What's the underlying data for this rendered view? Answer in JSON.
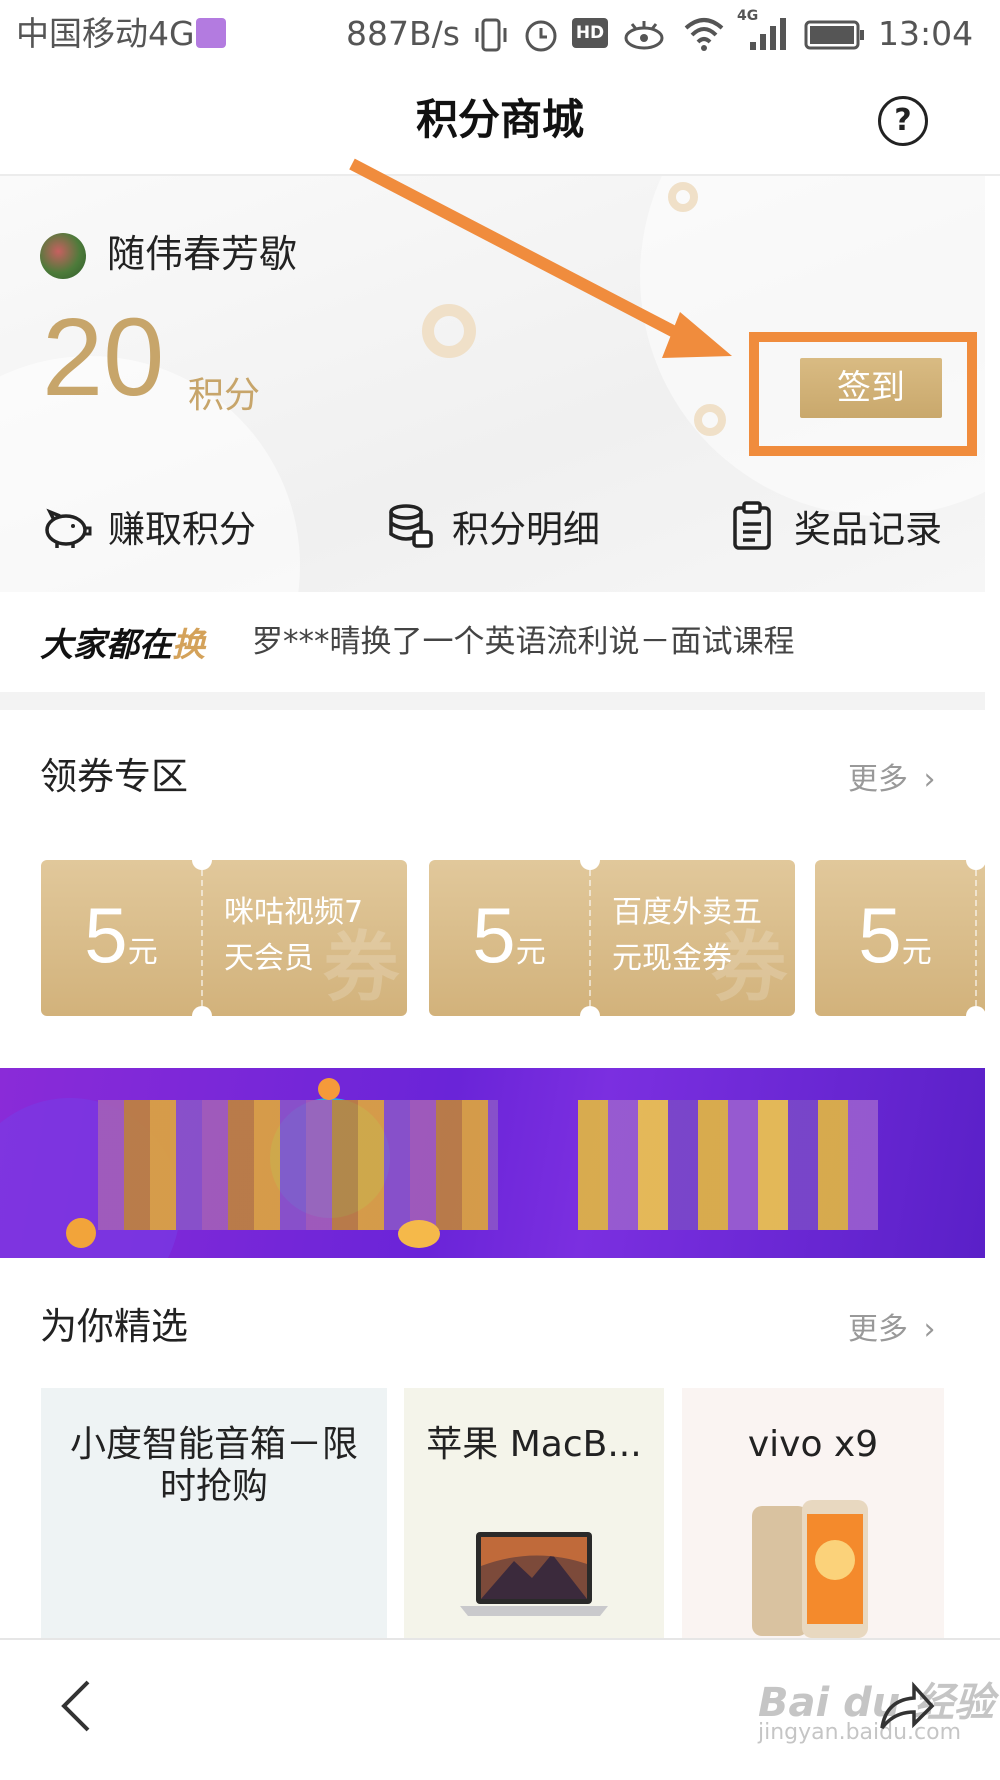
{
  "status_bar": {
    "carrier": "中国移动4G",
    "speed": "887B/s",
    "hd": "HD",
    "network": "4G",
    "time": "13:04"
  },
  "header": {
    "title": "积分商城",
    "help": "?"
  },
  "account": {
    "username": "随伟春芳歇",
    "points": "20",
    "points_unit": "积分",
    "checkin_label": "签到"
  },
  "actions": [
    {
      "label": "赚取积分",
      "icon": "piggy-bank-icon"
    },
    {
      "label": "积分明细",
      "icon": "coin-stack-icon"
    },
    {
      "label": "奖品记录",
      "icon": "clipboard-icon"
    }
  ],
  "ticker": {
    "brand_prefix": "大家都在",
    "brand_highlight": "换",
    "message": "罗***晴换了一个英语流利说－面试课程"
  },
  "coupons_section": {
    "title": "领券专区",
    "more": "更多",
    "coupons": [
      {
        "amount": "5",
        "currency": "元",
        "line1": "咪咕视频7",
        "line2": "天会员",
        "watermark": "券"
      },
      {
        "amount": "5",
        "currency": "元",
        "line1": "百度外卖五",
        "line2": "元现金券",
        "watermark": "券"
      },
      {
        "amount": "5",
        "currency": "元",
        "line1": "",
        "line2": "",
        "watermark": ""
      }
    ]
  },
  "picks_section": {
    "title": "为你精选",
    "more": "更多",
    "products": [
      {
        "title": "小度智能音箱－限时抢购"
      },
      {
        "title": "苹果 MacB..."
      },
      {
        "title": "vivo x9"
      }
    ]
  },
  "watermark": {
    "brand": "Bai du 经验",
    "url": "jingyan.baidu.com"
  },
  "colors": {
    "gold": "#c7a56a",
    "highlight_orange": "#f08c3d",
    "banner_purple": "#6a24d8"
  }
}
